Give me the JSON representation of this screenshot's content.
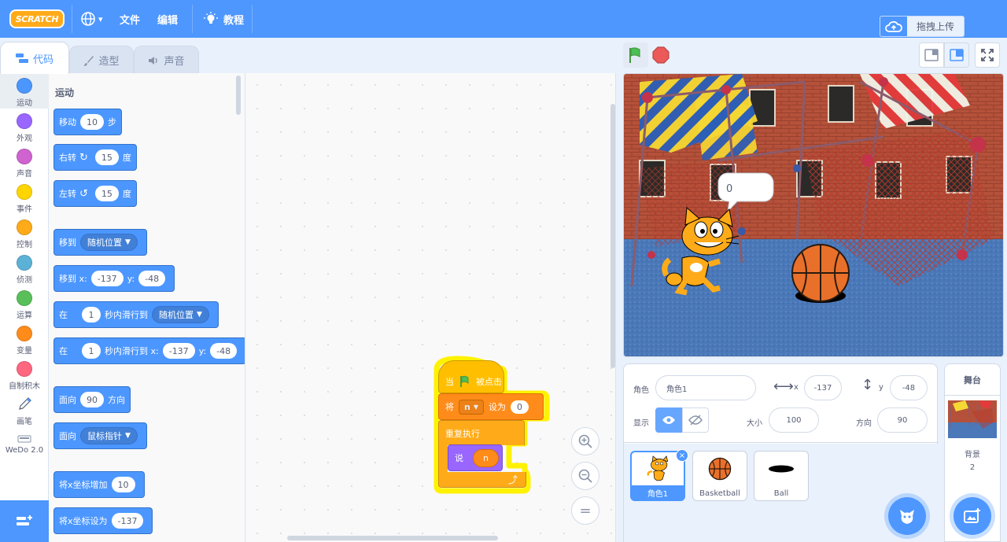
{
  "menu": {
    "logo": "SCRATCH",
    "language_caret": "▾",
    "file": "文件",
    "edit": "编辑",
    "tutorials": "教程",
    "upload": "拖拽上传"
  },
  "tabs": {
    "code": "代码",
    "costumes": "造型",
    "sounds": "声音"
  },
  "categories": [
    {
      "label": "运动",
      "color": "#4c97ff"
    },
    {
      "label": "外观",
      "color": "#9966ff"
    },
    {
      "label": "声音",
      "color": "#cf63cf"
    },
    {
      "label": "事件",
      "color": "#ffd500"
    },
    {
      "label": "控制",
      "color": "#ffab19"
    },
    {
      "label": "侦测",
      "color": "#5cb1d6"
    },
    {
      "label": "运算",
      "color": "#59c059"
    },
    {
      "label": "变量",
      "color": "#ff8c1a"
    },
    {
      "label": "自制积木",
      "color": "#ff6680"
    },
    {
      "label": "画笔",
      "color": "#0fbd8c"
    },
    {
      "label": "WeDo 2.0",
      "color": "#0fbd8c"
    }
  ],
  "palette": {
    "title": "运动",
    "move": {
      "pre": "移动",
      "val": "10",
      "post": "步"
    },
    "turn_right": {
      "pre": "右转",
      "val": "15",
      "post": "度"
    },
    "turn_left": {
      "pre": "左转",
      "val": "15",
      "post": "度"
    },
    "goto": {
      "pre": "移到",
      "drop": "随机位置"
    },
    "goto_xy": {
      "pre": "移到 x:",
      "x": "-137",
      "ylabel": "y:",
      "y": "-48"
    },
    "glide": {
      "pre": "在",
      "val": "1",
      "mid": "秒内滑行到",
      "drop": "随机位置"
    },
    "glide_xy": {
      "pre": "在",
      "val": "1",
      "mid": "秒内滑行到 x:",
      "x": "-137",
      "ylabel": "y:",
      "y": "-48"
    },
    "point_dir": {
      "pre": "面向",
      "val": "90",
      "post": "方向"
    },
    "point_towards": {
      "pre": "面向",
      "drop": "鼠标指针"
    },
    "change_x": {
      "pre": "将x坐标增加",
      "val": "10"
    },
    "set_x": {
      "pre": "将x坐标设为",
      "val": "-137"
    }
  },
  "script": {
    "hat_pre": "当",
    "hat_post": "被点击",
    "set_pre": "将",
    "set_var": "n",
    "set_mid": "设为",
    "set_val": "0",
    "forever": "重复执行",
    "say": "说",
    "say_var": "n"
  },
  "zoom": {
    "in": "+",
    "out": "−",
    "reset": "="
  },
  "stage": {
    "speech": "0"
  },
  "sprite_info": {
    "sprite_label": "角色",
    "sprite_name": "角色1",
    "x_label": "x",
    "x": "-137",
    "y_label": "y",
    "y": "-48",
    "show_label": "显示",
    "size_label": "大小",
    "size": "100",
    "dir_label": "方向",
    "direction": "90"
  },
  "sprites": [
    {
      "name": "角色1"
    },
    {
      "name": "Basketball"
    },
    {
      "name": "Ball"
    }
  ],
  "stage_panel": {
    "title": "舞台",
    "backdrops_label": "背景",
    "backdrops_count": "2"
  }
}
